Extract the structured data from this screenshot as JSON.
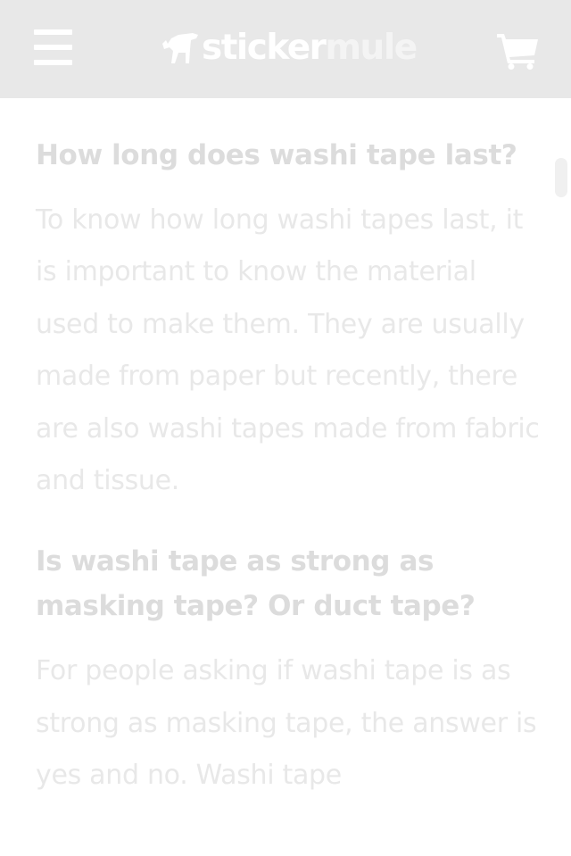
{
  "header": {
    "brand_primary": "sticker",
    "brand_secondary": "mule",
    "menu_icon": "hamburger-menu-icon",
    "cart_icon": "shopping-cart-icon",
    "background": "#e8e8e8"
  },
  "faq": [
    {
      "question": "How long does washi tape last?",
      "answer": "To know how long washi tapes last, it is important to know the material used to make them. They are usually made from paper but recently, there are also washi tapes made from fabric and tissue."
    },
    {
      "question": "Is washi tape as strong as masking tape? Or duct tape?",
      "answer": "For people asking if washi tape is as strong as masking tape, the answer is yes and no. Washi tape"
    }
  ],
  "colors": {
    "heading_text": "#dcdcdc",
    "body_text": "#e8e8e8"
  }
}
